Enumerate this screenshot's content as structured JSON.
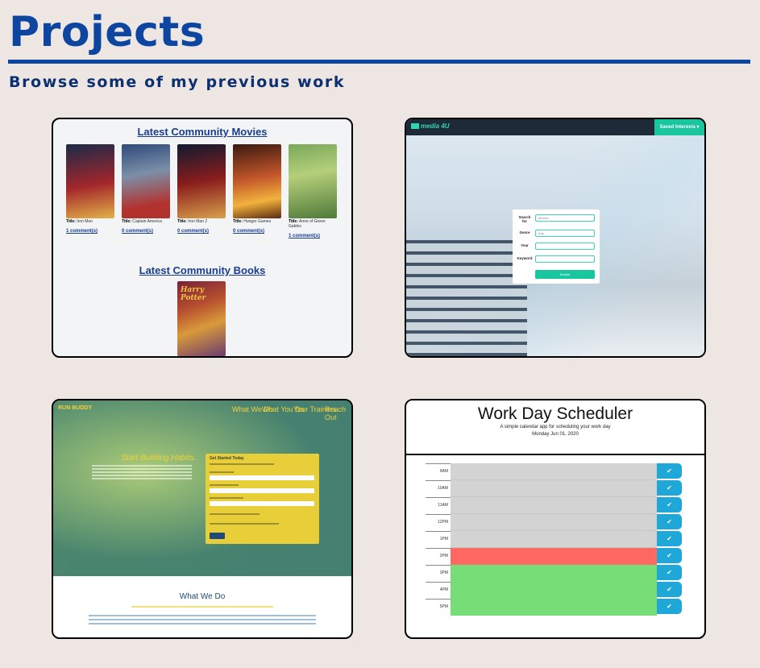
{
  "header": {
    "title": "Projects",
    "subtitle": "Browse some of my previous work"
  },
  "colors": {
    "brand_blue": "#0d46a0",
    "page_background": "#ede6e3",
    "scheduler_past": "#d3d3d3",
    "scheduler_present": "#ff6961",
    "scheduler_future": "#77dd77",
    "scheduler_save": "#1fa7d8",
    "media_accent": "#19c6a0"
  },
  "projects": [
    {
      "movies_heading": "Latest Community Movies",
      "books_heading": "Latest Community Books",
      "movies": [
        {
          "title_label": "Title:",
          "title": "Iron Man",
          "comments": "1 comment(s)"
        },
        {
          "title_label": "Title:",
          "title": "Captain America",
          "comments": "0 comment(s)"
        },
        {
          "title_label": "Title:",
          "title": "Iron Man 2",
          "comments": "0 comment(s)"
        },
        {
          "title_label": "Title:",
          "title": "Hunger Games",
          "comments": "0 comment(s)"
        },
        {
          "title_label": "Title:",
          "title": "Anne of Green Gables",
          "comments": "1 comment(s)"
        }
      ],
      "book_cover_text": "Harry Potter"
    },
    {
      "logo": "media 4U",
      "saved_button": "Saved Interests ▾",
      "form": {
        "search_label": "Search for",
        "search_value": "Movies",
        "genre_label": "Genre",
        "genre_value": "Any",
        "year_label": "Year",
        "keyword_label": "Keyword",
        "submit": "Submit"
      }
    },
    {
      "brand": "RUN BUDDY",
      "nav": [
        "What We Do",
        "What You Do",
        "Your Trainers",
        "Reach Out"
      ],
      "hero_heading": "Start Building Habits.",
      "form_heading": "Get Started Today",
      "section_heading": "What We Do"
    },
    {
      "title": "Work Day Scheduler",
      "subtitle": "A simple calendar app for scheduling your work day",
      "date": "Monday Jun 01, 2020",
      "save_icon": "check-icon",
      "hours": [
        {
          "label": "9AM",
          "status": "past"
        },
        {
          "label": "10AM",
          "status": "past"
        },
        {
          "label": "11AM",
          "status": "past"
        },
        {
          "label": "12PM",
          "status": "past"
        },
        {
          "label": "1PM",
          "status": "past"
        },
        {
          "label": "2PM",
          "status": "present"
        },
        {
          "label": "3PM",
          "status": "future"
        },
        {
          "label": "4PM",
          "status": "future"
        },
        {
          "label": "5PM",
          "status": "future"
        }
      ]
    }
  ]
}
